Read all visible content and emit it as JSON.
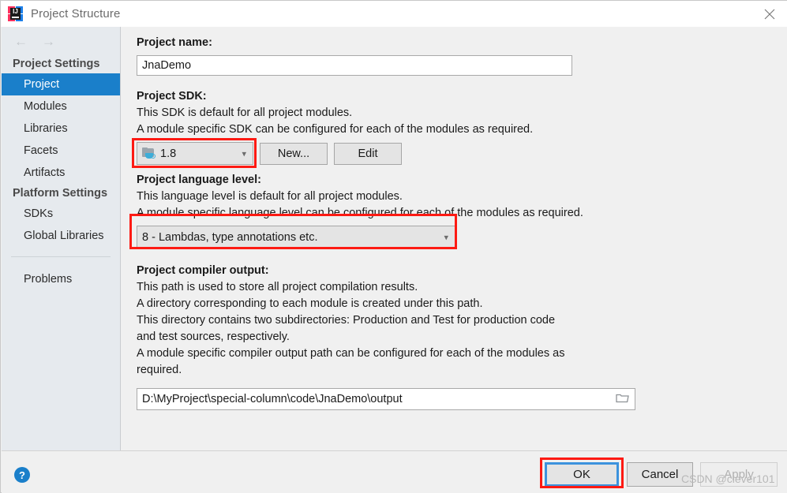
{
  "window": {
    "title": "Project Structure",
    "app_icon": "intellij-idea-icon",
    "close_icon": "close-icon"
  },
  "sidebar": {
    "back_icon": "arrow-left-icon",
    "forward_icon": "arrow-right-icon",
    "groups": [
      {
        "label": "Project Settings"
      },
      {
        "label": "Platform Settings"
      }
    ],
    "items": [
      {
        "label": "Project",
        "selected": true
      },
      {
        "label": "Modules",
        "selected": false
      },
      {
        "label": "Libraries",
        "selected": false
      },
      {
        "label": "Facets",
        "selected": false
      },
      {
        "label": "Artifacts",
        "selected": false
      },
      {
        "label": "SDKs",
        "selected": false
      },
      {
        "label": "Global Libraries",
        "selected": false
      },
      {
        "label": "Problems",
        "selected": false
      }
    ]
  },
  "main": {
    "project_name": {
      "label": "Project name:",
      "value": "JnaDemo"
    },
    "project_sdk": {
      "label": "Project SDK:",
      "desc_line1": "This SDK is default for all project modules.",
      "desc_line2": "A module specific SDK can be configured for each of the modules as required.",
      "selected": "1.8",
      "sdk_icon": "java-sdk-folder-icon",
      "chevron_icon": "chevron-down-icon",
      "new_button": "New...",
      "edit_button": "Edit"
    },
    "language_level": {
      "label": "Project language level:",
      "desc_line1": "This language level is default for all project modules.",
      "desc_line2": "A module specific language level can be configured for each of the modules as required.",
      "selected": "8 - Lambdas, type annotations etc.",
      "chevron_icon": "chevron-down-icon"
    },
    "compiler_output": {
      "label": "Project compiler output:",
      "desc_line1": "This path is used to store all project compilation results.",
      "desc_line2": "A directory corresponding to each module is created under this path.",
      "desc_line3": "This directory contains two subdirectories: Production and Test for production code",
      "desc_line4": "and test sources, respectively.",
      "desc_line5": "A module specific compiler output path can be configured for each of the modules as",
      "desc_line6": "required.",
      "path_value": "D:\\MyProject\\special-column\\code\\JnaDemo\\output",
      "browse_icon": "folder-browse-icon"
    }
  },
  "footer": {
    "help_icon": "help-icon",
    "help_glyph": "?",
    "ok_label": "OK",
    "cancel_label": "Cancel",
    "apply_label": "Apply",
    "watermark": "CSDN @clever101"
  },
  "annotations": {
    "highlight_color": "#fd1a13",
    "focus_color": "#3c92dd",
    "selection_color": "#1a7fca"
  }
}
